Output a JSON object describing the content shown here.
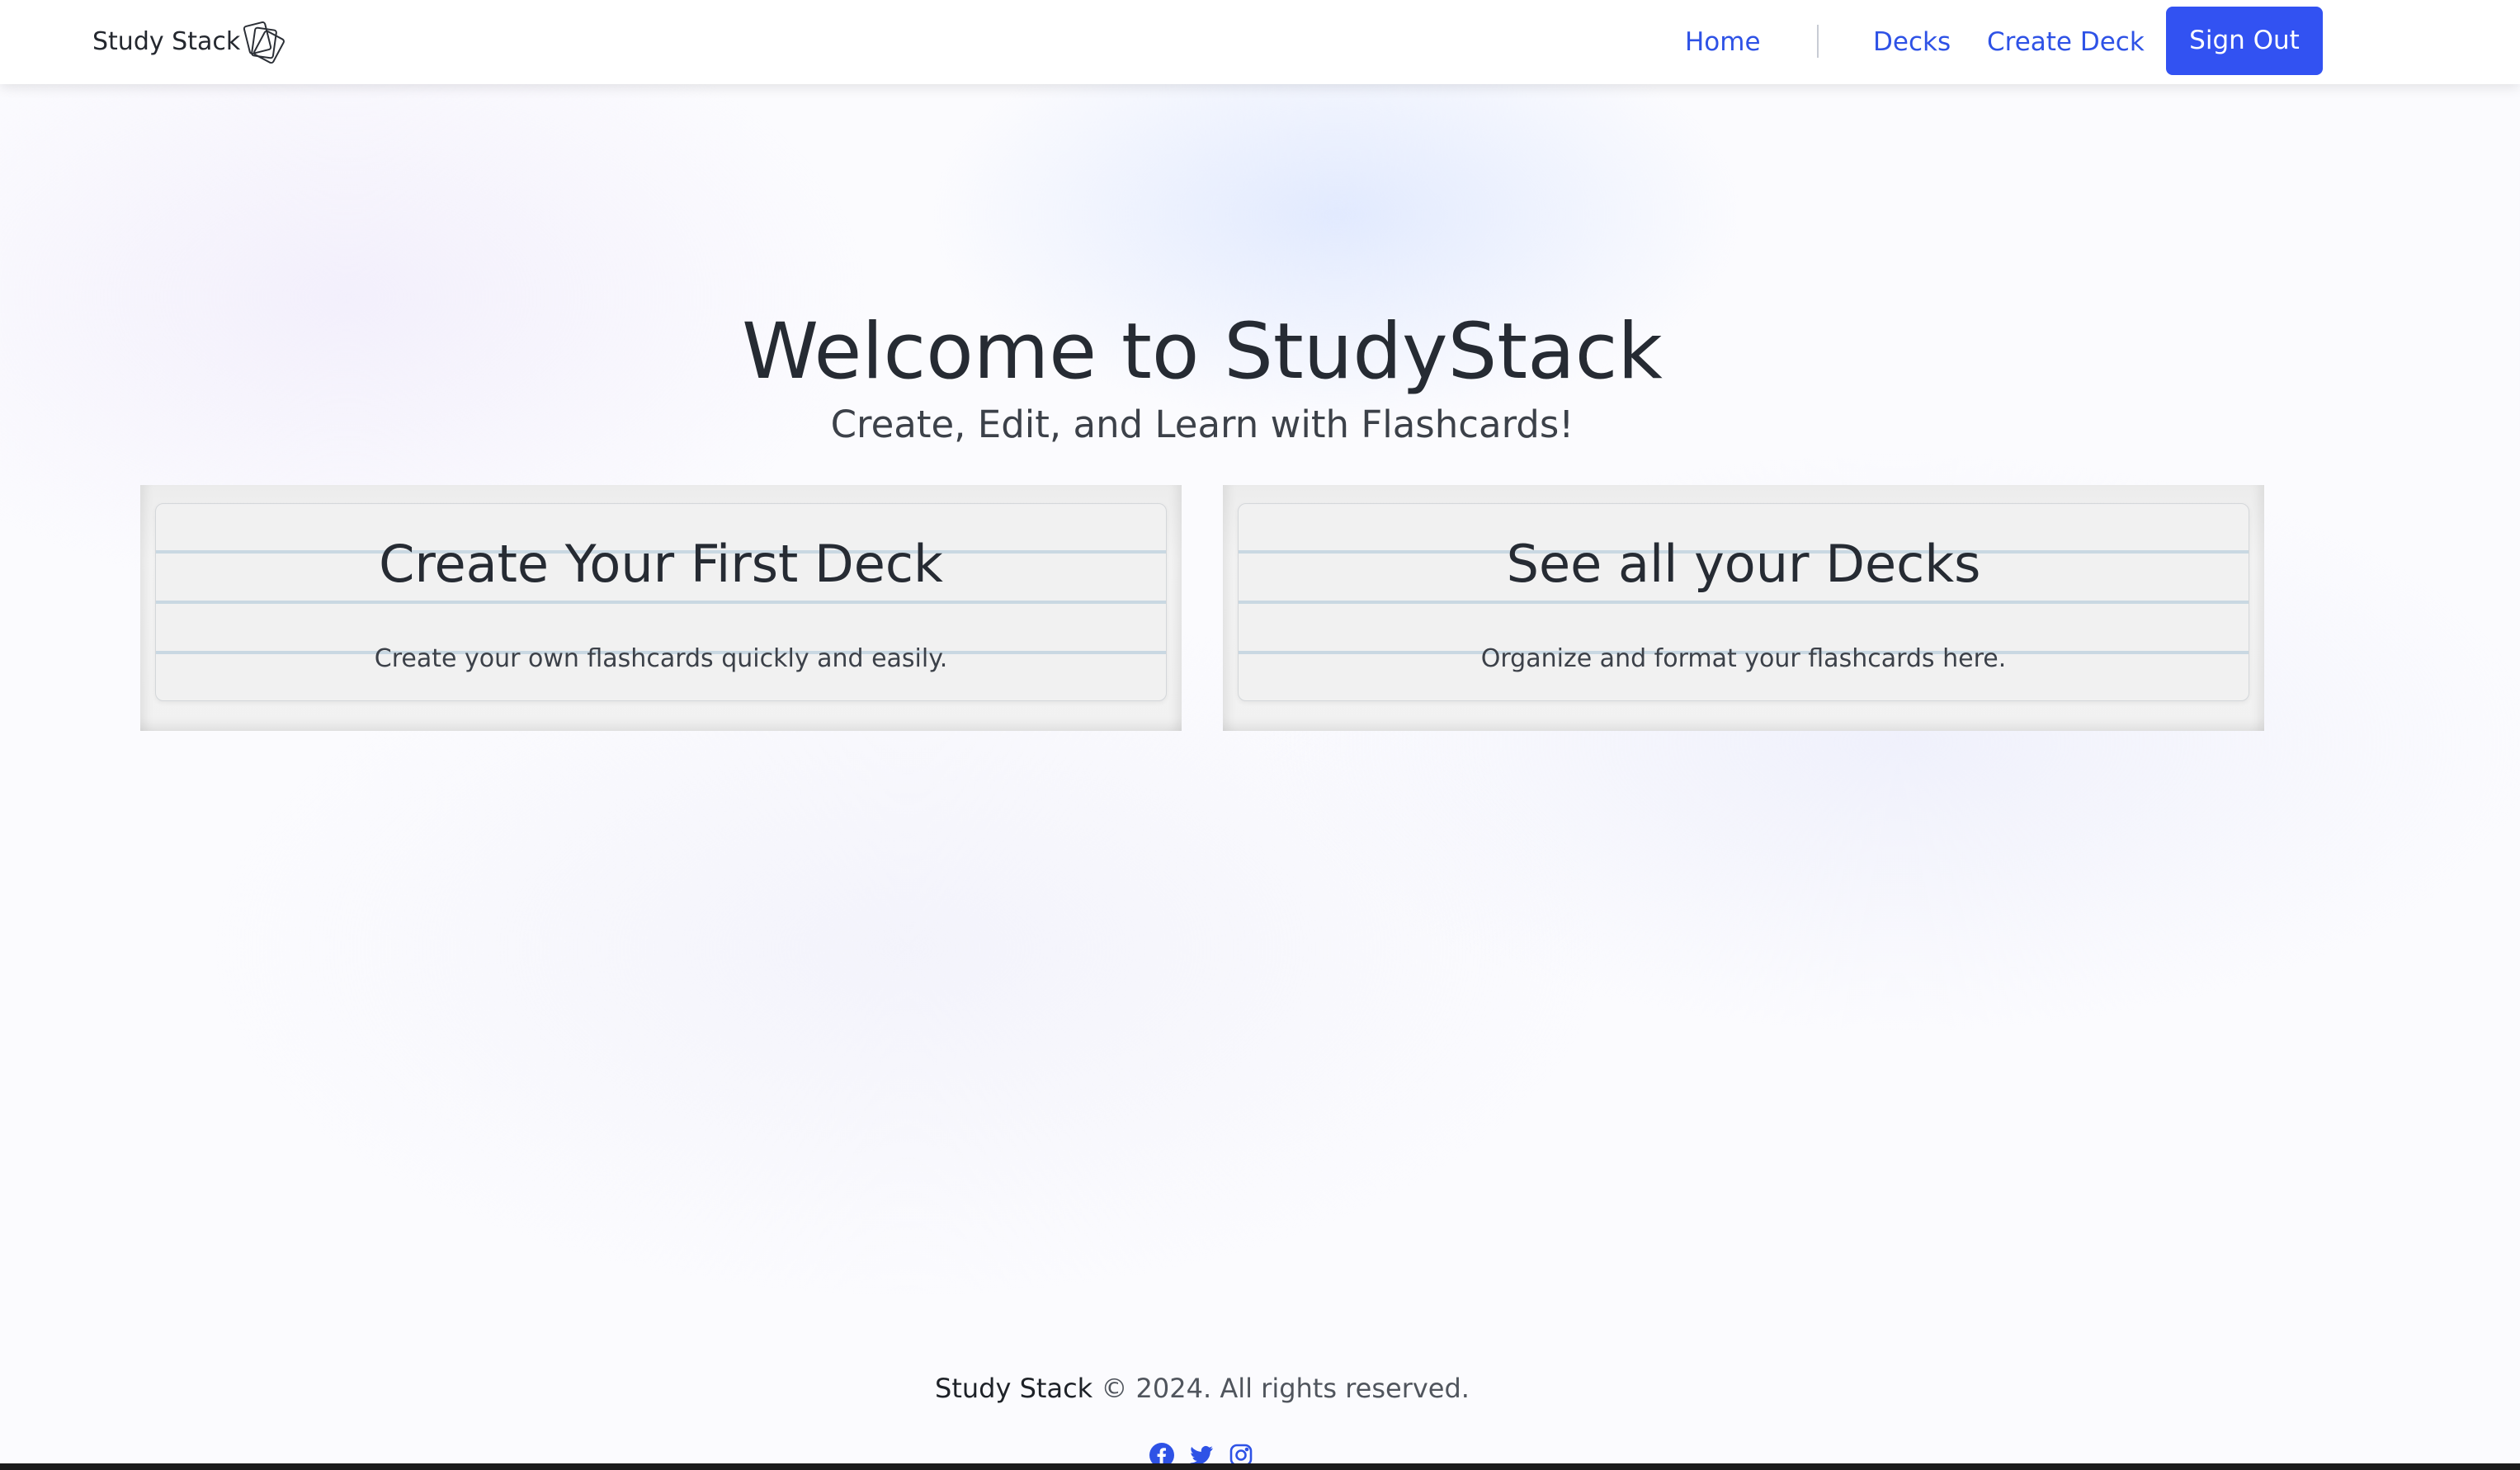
{
  "nav": {
    "brand": "Study Stack",
    "links": {
      "home": "Home",
      "decks": "Decks",
      "create_deck": "Create Deck"
    },
    "sign_out": "Sign Out",
    "accent_color": "#3252f2"
  },
  "hero": {
    "title": "Welcome to StudyStack",
    "subtitle": "Create, Edit, and Learn with Flashcards!"
  },
  "cards": [
    {
      "title": "Create Your First Deck",
      "text": "Create your own flashcards quickly and easily."
    },
    {
      "title": "See all your Decks",
      "text": "Organize and format your flashcards here."
    }
  ],
  "footer": {
    "brand": "Study Stack",
    "copyright": "© 2024. All rights reserved.",
    "social_icons": [
      "facebook-icon",
      "twitter-icon",
      "instagram-icon"
    ]
  }
}
